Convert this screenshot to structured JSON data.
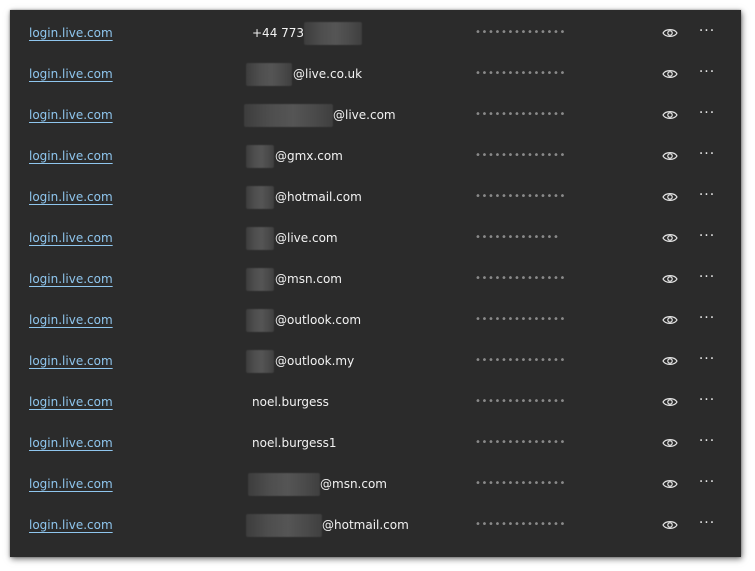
{
  "password_manager": {
    "rows": [
      {
        "site": "login.live.com",
        "username": "+44 7731",
        "password_mask": "••••••••••••••"
      },
      {
        "site": "login.live.com",
        "username": "@live.co.uk",
        "password_mask": "••••••••••••••"
      },
      {
        "site": "login.live.com",
        "username": "@live.com",
        "password_mask": "••••••••••••••"
      },
      {
        "site": "login.live.com",
        "username": "@gmx.com",
        "password_mask": "••••••••••••••"
      },
      {
        "site": "login.live.com",
        "username": "@hotmail.com",
        "password_mask": "••••••••••••••"
      },
      {
        "site": "login.live.com",
        "username": "@live.com",
        "password_mask": "•••••••••••••"
      },
      {
        "site": "login.live.com",
        "username": "@msn.com",
        "password_mask": "••••••••••••••"
      },
      {
        "site": "login.live.com",
        "username": "@outlook.com",
        "password_mask": "••••••••••••••"
      },
      {
        "site": "login.live.com",
        "username": "@outlook.my",
        "password_mask": "••••••••••••••"
      },
      {
        "site": "login.live.com",
        "username": "noel.burgess",
        "password_mask": "••••••••••••••"
      },
      {
        "site": "login.live.com",
        "username": "noel.burgess1",
        "password_mask": "••••••••••••••"
      },
      {
        "site": "login.live.com",
        "username": "@msn.com",
        "password_mask": "••••••••••••••"
      },
      {
        "site": "login.live.com",
        "username": "@hotmail.com",
        "password_mask": "••••••••••••••"
      }
    ],
    "show_password_icon": "eye-icon",
    "more_actions_icon": "more-horizontal-icon",
    "more_actions_glyph": "···",
    "colors": {
      "background": "#2b2b2b",
      "link": "#8fc6ee",
      "text": "#f2f2f2",
      "mask": "#8a8a8a"
    }
  }
}
